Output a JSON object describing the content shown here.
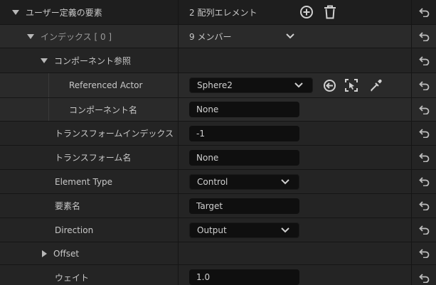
{
  "rows": {
    "user_elements": {
      "label": "ユーザー定義の要素",
      "value": "2 配列エレメント"
    },
    "index": {
      "label": "インデックス [ 0 ]",
      "value": "9 メンバー"
    },
    "component_ref": {
      "label": "コンポーネント参照"
    },
    "referenced_actor": {
      "label": "Referenced Actor",
      "value": "Sphere2"
    },
    "component_name": {
      "label": "コンポーネント名",
      "value": "None"
    },
    "transform_index": {
      "label": "トランスフォームインデックス",
      "value": "-1"
    },
    "transform_name": {
      "label": "トランスフォーム名",
      "value": "None"
    },
    "element_type": {
      "label": "Element Type",
      "value": "Control"
    },
    "element_name": {
      "label": "要素名",
      "value": "Target"
    },
    "direction": {
      "label": "Direction",
      "value": "Output"
    },
    "offset": {
      "label": "Offset"
    },
    "weight": {
      "label": "ウェイト",
      "value": "1.0"
    }
  },
  "icons": {
    "add": "plus-circle-icon",
    "delete": "trash-icon",
    "use_selected": "arrow-left-circle-icon",
    "browse": "select-actor-icon",
    "picker": "eyedropper-icon",
    "reset": "reset-arrow-icon",
    "expand": "chevron-down-icon"
  },
  "colors": {
    "background": "#151515",
    "row": "#242424",
    "input": "#0f0f0f",
    "text": "#c8c8c8",
    "muted_text": "#9a9a9a"
  }
}
